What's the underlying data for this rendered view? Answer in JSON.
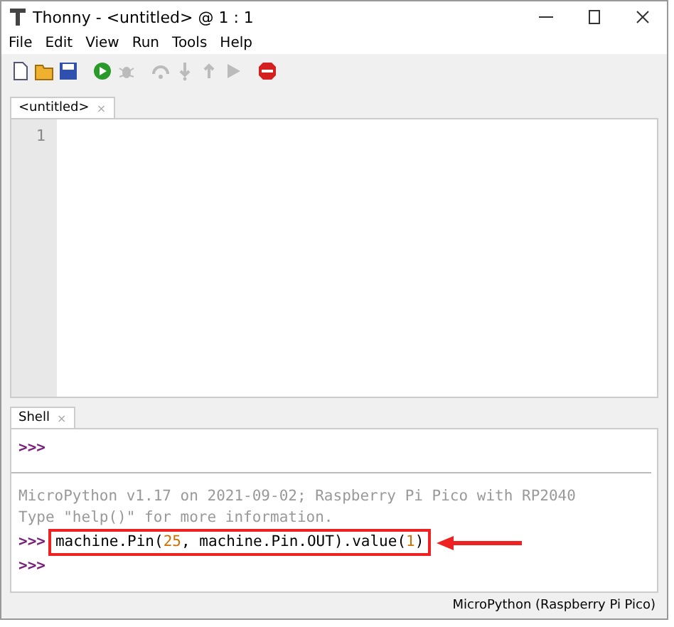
{
  "window": {
    "title": "Thonny  -  <untitled>  @  1 : 1"
  },
  "menu": [
    "File",
    "Edit",
    "View",
    "Run",
    "Tools",
    "Help"
  ],
  "toolbar": [
    {
      "kind": "new",
      "disabled": false
    },
    {
      "kind": "open",
      "disabled": false
    },
    {
      "kind": "save",
      "disabled": false
    },
    {
      "kind": "run",
      "disabled": false
    },
    {
      "kind": "debug",
      "disabled": true
    },
    {
      "kind": "step-over",
      "disabled": true
    },
    {
      "kind": "step-into",
      "disabled": true
    },
    {
      "kind": "step-out",
      "disabled": true
    },
    {
      "kind": "resume",
      "disabled": true
    },
    {
      "kind": "stop",
      "disabled": false
    }
  ],
  "editor": {
    "tab": {
      "label": "<untitled>",
      "close": "×"
    },
    "line_numbers": [
      "1"
    ]
  },
  "shell": {
    "tab": {
      "label": "Shell",
      "close": "×"
    },
    "lines": [
      {
        "kind": "prompt",
        "prompt": ">>>"
      },
      {
        "kind": "separator"
      },
      {
        "kind": "output",
        "text": "MicroPython v1.17 on 2021-09-02; Raspberry Pi Pico with RP2040"
      },
      {
        "kind": "output",
        "text": "Type \"help()\" for more information."
      },
      {
        "kind": "input",
        "prompt": ">>>",
        "highlighted": true,
        "parts": [
          {
            "kind": "code",
            "text": "machine.Pin("
          },
          {
            "kind": "number",
            "text": "25"
          },
          {
            "kind": "code",
            "text": ", machine.Pin.OUT).value("
          },
          {
            "kind": "number",
            "text": "1"
          },
          {
            "kind": "code",
            "text": ")"
          }
        ]
      },
      {
        "kind": "prompt",
        "prompt": ">>>"
      }
    ]
  },
  "status_bar": {
    "text": "MicroPython (Raspberry Pi Pico)"
  }
}
